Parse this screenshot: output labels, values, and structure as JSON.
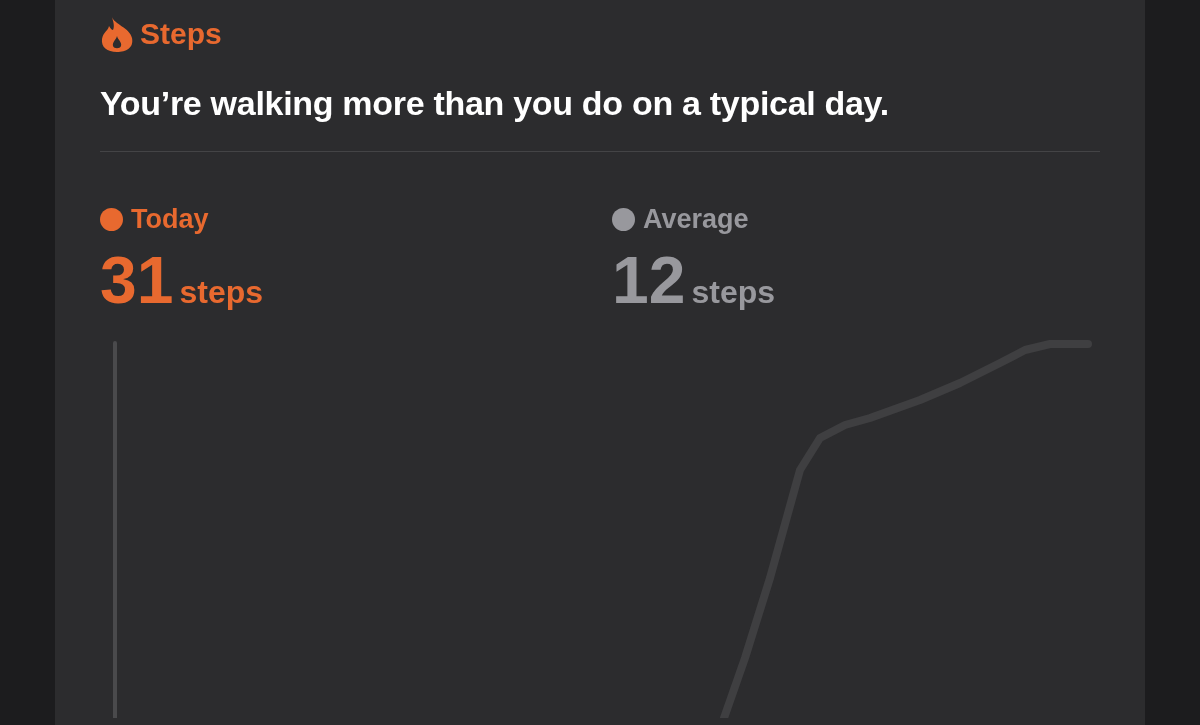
{
  "card": {
    "title": "Steps",
    "headline": "You’re walking more than you do on a typical day.",
    "stats": [
      {
        "label": "Today",
        "value": "31",
        "unit": "steps",
        "color": "#e8692f"
      },
      {
        "label": "Average",
        "value": "12",
        "unit": "steps",
        "color": "#98989d"
      }
    ]
  }
}
